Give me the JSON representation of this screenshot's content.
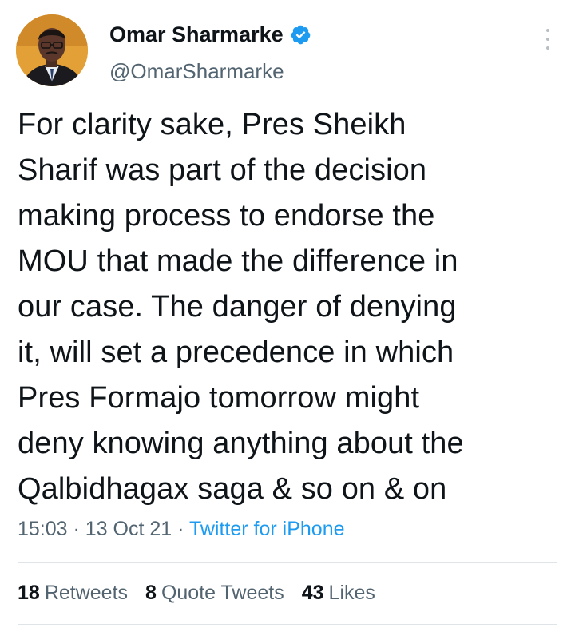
{
  "author": {
    "name": "Omar Sharmarke",
    "handle": "@OmarSharmarke",
    "verified_color": "#1d9bf0"
  },
  "tweet": {
    "lines": [
      "For clarity sake, Pres Sheikh",
      "Sharif was part of the decision",
      "making process to endorse the",
      "MOU that made the difference in",
      "our case. The danger of denying",
      "it, will set a precedence in which",
      "Pres Formajo tomorrow might",
      "deny knowing anything about the",
      "Qalbidhagax saga & so on & on"
    ],
    "time": "15:03",
    "date": "13 Oct 21",
    "source": "Twitter for iPhone"
  },
  "stats": {
    "retweets_count": "18",
    "retweets_label": "Retweets",
    "quotes_count": "8",
    "quotes_label": "Quote Tweets",
    "likes_count": "43",
    "likes_label": "Likes"
  },
  "icons": {
    "more": "more-options-icon",
    "verified": "verified-badge-icon"
  }
}
